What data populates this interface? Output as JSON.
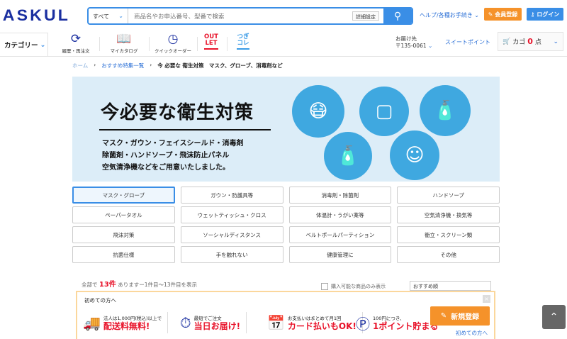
{
  "header": {
    "logo": "ASKUL",
    "search_scope": "すべて",
    "search_placeholder": "商品名やお申込番号、型番で検索",
    "advanced": "詳細設定",
    "help": "ヘルプ/各種お手続き",
    "register": "会員登録",
    "login": "ログイン"
  },
  "nav": {
    "category": "カテゴリー",
    "items": [
      {
        "label": "履歴・再注文",
        "icon": "refresh-icon"
      },
      {
        "label": "マイカタログ",
        "icon": "book-icon"
      },
      {
        "label": "クイックオーダー",
        "icon": "gauge-icon"
      }
    ],
    "outlet": [
      "OUT",
      "LET"
    ],
    "tsugi": [
      "つぎ",
      "コレ"
    ],
    "delivery_label": "お届け先",
    "delivery_zip": "〒135-0061",
    "sweet_point": "スイートポイント",
    "cart_label": "カゴ",
    "cart_count": "0",
    "cart_unit": "点"
  },
  "breadcrumb": [
    "ホーム",
    "おすすめ特集一覧",
    "今 必要な 衛生対策　マスク、グローブ、消毒剤など"
  ],
  "banner": {
    "title": "今必要な衛生対策",
    "lines": [
      "マスク・ガウン・フェイスシールド・消毒剤",
      "除菌剤・ハンドソープ・飛沫防止パネル",
      "空気清浄機などをご用意いたしました。"
    ]
  },
  "categories": [
    "マスク・グローブ",
    "ガウン・防護具等",
    "消毒剤・除菌剤",
    "ハンドソープ",
    "ペーパータオル",
    "ウェットティッシュ・クロス",
    "体温計・うがい薬等",
    "空気清浄機・換気等",
    "飛沫対策",
    "ソーシャルディスタンス",
    "ベルトポールパーティション",
    "衝立・スクリーン類",
    "抗菌仕様",
    "手を触れない",
    "健康管理に",
    "その他"
  ],
  "results": {
    "prefix": "全部で",
    "count": "13件",
    "suffix": "ありますー1件目〜13件目を表示",
    "checkbox": "購入可能な商品のみ表示",
    "sort": "おすすめ順"
  },
  "popup": {
    "title": "初めての方へ",
    "features": [
      {
        "small": "法人は1,000円(税込)以上で",
        "big": "配送料無料!",
        "icon": "truck-icon"
      },
      {
        "small": "最短でご注文",
        "big": "当日お届け!",
        "icon": "clock-box-icon"
      },
      {
        "small": "お支払いはまとめて月1回",
        "big": "カード払いもOK!",
        "icon": "calendar-icon"
      },
      {
        "small": "100円につき、",
        "big": "1ポイント貯まる",
        "icon": "coin-icon"
      }
    ],
    "new_register": "新規登録",
    "first_link": "初めての方へ"
  },
  "colors": {
    "brand": "#1a2fa0",
    "accent": "#3a8ee6",
    "orange": "#f5922a",
    "red": "#e8132a"
  }
}
